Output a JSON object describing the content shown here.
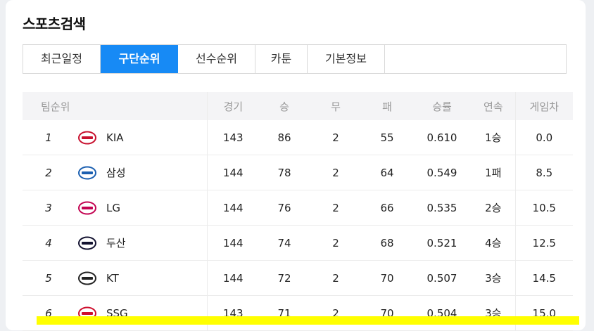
{
  "page": {
    "title": "스포츠검색"
  },
  "tabs": [
    {
      "label": "최근일정",
      "active": false
    },
    {
      "label": "구단순위",
      "active": true
    },
    {
      "label": "선수순위",
      "active": false
    },
    {
      "label": "카툰",
      "active": false
    },
    {
      "label": "기본정보",
      "active": false
    }
  ],
  "table": {
    "headers": {
      "team": "팀순위",
      "games": "경기",
      "wins": "승",
      "draws": "무",
      "losses": "패",
      "pct": "승률",
      "streak": "연속",
      "gb": "게임차"
    },
    "rows": [
      {
        "rank": "1",
        "team": "KIA",
        "games": "143",
        "wins": "86",
        "draws": "2",
        "losses": "55",
        "pct": "0.610",
        "streak": "1승",
        "gb": "0.0",
        "logo_color": "#c8102e"
      },
      {
        "rank": "2",
        "team": "삼성",
        "games": "144",
        "wins": "78",
        "draws": "2",
        "losses": "64",
        "pct": "0.549",
        "streak": "1패",
        "gb": "8.5",
        "logo_color": "#1b5fb0"
      },
      {
        "rank": "3",
        "team": "LG",
        "games": "144",
        "wins": "76",
        "draws": "2",
        "losses": "66",
        "pct": "0.535",
        "streak": "2승",
        "gb": "10.5",
        "logo_color": "#c30452"
      },
      {
        "rank": "4",
        "team": "두산",
        "games": "144",
        "wins": "74",
        "draws": "2",
        "losses": "68",
        "pct": "0.521",
        "streak": "4승",
        "gb": "12.5",
        "logo_color": "#131230"
      },
      {
        "rank": "5",
        "team": "KT",
        "games": "144",
        "wins": "72",
        "draws": "2",
        "losses": "70",
        "pct": "0.507",
        "streak": "3승",
        "gb": "14.5",
        "logo_color": "#222222"
      },
      {
        "rank": "6",
        "team": "SSG",
        "games": "143",
        "wins": "71",
        "draws": "2",
        "losses": "70",
        "pct": "0.504",
        "streak": "3승",
        "gb": "15.0",
        "logo_color": "#ce0e2d"
      }
    ]
  },
  "colors": {
    "accent": "#178af5",
    "gb_text": "#e0333a",
    "highlight": "#ffff00"
  }
}
